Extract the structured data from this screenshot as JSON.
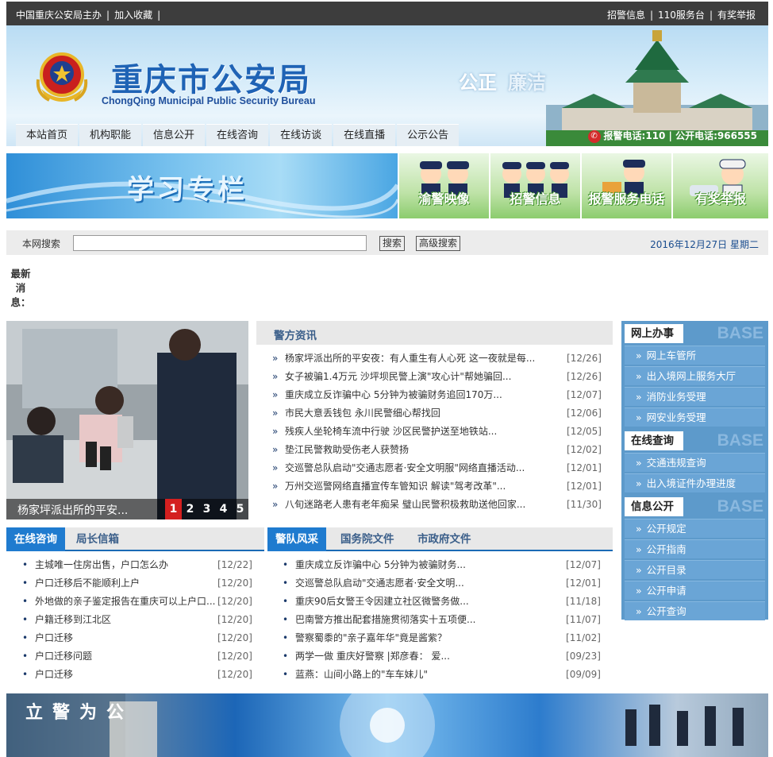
{
  "topbar": {
    "host": "中国重庆公安局主办",
    "bookmark": "加入收藏",
    "trail_sep": "|",
    "recruit": "招警信息",
    "service110": "110服务台",
    "report": "有奖举报"
  },
  "header": {
    "title_cn": "重庆市公安局",
    "title_en": "ChongQing Municipal Public Security Bureau",
    "slogan_a": "公正",
    "slogan_b": "廉洁",
    "hotline": "报警电话:110 | 公开电话:966555"
  },
  "nav": [
    "本站首页",
    "机构职能",
    "信息公开",
    "在线咨询",
    "在线访谈",
    "在线直播",
    "公示公告"
  ],
  "banner": {
    "study": "学习专栏",
    "quick": [
      "渝警映像",
      "招警信息",
      "报警服务电话",
      "有奖举报"
    ]
  },
  "search": {
    "label": "本网搜索",
    "value": "",
    "search_btn": "搜索",
    "advanced_btn": "高级搜索",
    "date": "2016年12月27日 星期二"
  },
  "latest_label": "最新消息：",
  "slide": {
    "caption": "杨家坪派出所的平安...",
    "pages": [
      "1",
      "2",
      "3",
      "4",
      "5"
    ],
    "current": "1"
  },
  "police_news": {
    "title": "警方资讯",
    "items": [
      {
        "text": "杨家坪派出所的平安夜：有人重生有人心死 这一夜就是每...",
        "date": "[12/26]"
      },
      {
        "text": "女子被骗1.4万元 沙坪坝民警上演\"攻心计\"帮她骗回...",
        "date": "[12/26]"
      },
      {
        "text": "重庆成立反诈骗中心 5分钟为被骗财务追回170万...",
        "date": "[12/07]"
      },
      {
        "text": "市民大意丢钱包 永川民警细心帮找回",
        "date": "[12/06]"
      },
      {
        "text": "残疾人坐轮椅车流中行驶 沙区民警护送至地铁站...",
        "date": "[12/05]"
      },
      {
        "text": "垫江民警救助受伤老人获赞扬",
        "date": "[12/02]"
      },
      {
        "text": "交巡警总队启动\"交通志愿者·安全文明服\"网络直播活动...",
        "date": "[12/01]"
      },
      {
        "text": "万州交巡警网络直播宣传车管知识 解读\"驾考改革\"...",
        "date": "[12/01]"
      },
      {
        "text": "八旬迷路老人患有老年痴呆 璧山民警积极救助送他回家...",
        "date": "[11/30]"
      }
    ]
  },
  "consult": {
    "tabs": [
      "在线咨询",
      "局长信箱"
    ],
    "items": [
      {
        "text": "主城唯一住房出售，户口怎么办",
        "date": "[12/22]"
      },
      {
        "text": "户口迁移后不能顺利上户",
        "date": "[12/20]"
      },
      {
        "text": "外地做的亲子鉴定报告在重庆可以上户口...",
        "date": "[12/20]"
      },
      {
        "text": "户籍迁移到江北区",
        "date": "[12/20]"
      },
      {
        "text": "户口迁移",
        "date": "[12/20]"
      },
      {
        "text": "户口迁移问题",
        "date": "[12/20]"
      },
      {
        "text": "户口迁移",
        "date": "[12/20]"
      }
    ]
  },
  "team": {
    "tabs": [
      "警队风采",
      "国务院文件",
      "市政府文件"
    ],
    "items": [
      {
        "text": "重庆成立反诈骗中心 5分钟为被骗财务...",
        "date": "[12/07]"
      },
      {
        "text": "交巡警总队启动\"交通志愿者·安全文明...",
        "date": "[12/01]"
      },
      {
        "text": "重庆90后女警王令因建立社区微警务做...",
        "date": "[11/18]"
      },
      {
        "text": "巴南警方推出配套措施贯彻落实十五项便...",
        "date": "[11/07]"
      },
      {
        "text": "警察蜀黍的\"亲子嘉年华\"竟是酱紫？",
        "date": "[11/02]"
      },
      {
        "text": "两学一做 重庆好警察 |郑彦春： 爱...",
        "date": "[09/23]"
      },
      {
        "text": "蓝燕：山间小路上的\"车车妹儿\"",
        "date": "[09/09]"
      }
    ]
  },
  "sidebar": {
    "base_word": "BASE",
    "sections": [
      {
        "title": "网上办事",
        "items": [
          "网上车管所",
          "出入境网上服务大厅",
          "消防业务受理",
          "网安业务受理"
        ]
      },
      {
        "title": "在线查询",
        "items": [
          "交通违规查询",
          "出入境证件办理进度"
        ]
      },
      {
        "title": "信息公开",
        "items": [
          "公开规定",
          "公开指南",
          "公开目录",
          "公开申请",
          "公开查询"
        ]
      }
    ]
  },
  "footer": {
    "sign": "立警为公"
  },
  "colors": {
    "topbar": "#3d3d3d",
    "title_blue": "#1f63b5",
    "sidebar_blue": "#5d9acb",
    "active_tab": "#1f7bcf",
    "slide_active": "#d41f1f"
  }
}
